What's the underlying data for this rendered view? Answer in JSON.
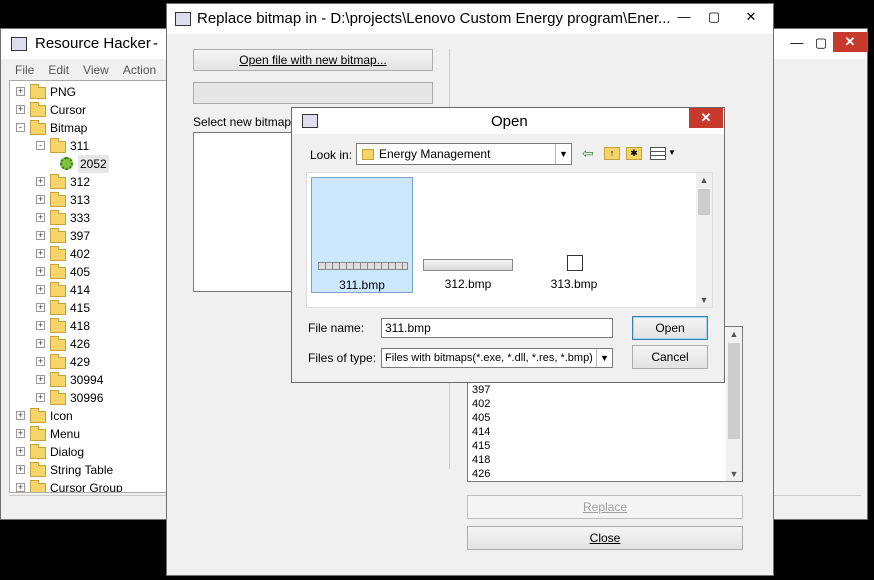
{
  "rh": {
    "title": "Resource Hacker",
    "title_suffix": "-",
    "menu": [
      "File",
      "Edit",
      "View",
      "Action"
    ],
    "tree": [
      {
        "label": "PNG",
        "level": 0,
        "exp": "+"
      },
      {
        "label": "Cursor",
        "level": 0,
        "exp": "+"
      },
      {
        "label": "Bitmap",
        "level": 0,
        "exp": "-"
      },
      {
        "label": "311",
        "level": 1,
        "exp": "-",
        "open": true
      },
      {
        "label": "2052",
        "level": 2,
        "exp": "",
        "gear": true
      },
      {
        "label": "312",
        "level": 1,
        "exp": "+"
      },
      {
        "label": "313",
        "level": 1,
        "exp": "+"
      },
      {
        "label": "333",
        "level": 1,
        "exp": "+"
      },
      {
        "label": "397",
        "level": 1,
        "exp": "+"
      },
      {
        "label": "402",
        "level": 1,
        "exp": "+"
      },
      {
        "label": "405",
        "level": 1,
        "exp": "+"
      },
      {
        "label": "414",
        "level": 1,
        "exp": "+"
      },
      {
        "label": "415",
        "level": 1,
        "exp": "+"
      },
      {
        "label": "418",
        "level": 1,
        "exp": "+"
      },
      {
        "label": "426",
        "level": 1,
        "exp": "+"
      },
      {
        "label": "429",
        "level": 1,
        "exp": "+"
      },
      {
        "label": "30994",
        "level": 1,
        "exp": "+"
      },
      {
        "label": "30996",
        "level": 1,
        "exp": "+"
      },
      {
        "label": "Icon",
        "level": 0,
        "exp": "+"
      },
      {
        "label": "Menu",
        "level": 0,
        "exp": "+"
      },
      {
        "label": "Dialog",
        "level": 0,
        "exp": "+"
      },
      {
        "label": "String Table",
        "level": 0,
        "exp": "+"
      },
      {
        "label": "Cursor Group",
        "level": 0,
        "exp": "+"
      }
    ]
  },
  "rep": {
    "title": "Replace bitmap in - D:\\projects\\Lenovo Custom Energy program\\Ener...",
    "open_btn": "Open file with new bitmap...",
    "select_label": "Select new bitmap:",
    "list": [
      "397",
      "402",
      "405",
      "414",
      "415",
      "418",
      "426"
    ],
    "replace_btn": "Replace",
    "close_btn": "Close"
  },
  "open": {
    "title": "Open",
    "lookin_label": "Look in:",
    "lookin_value": "Energy Management",
    "files": [
      "311.bmp",
      "312.bmp",
      "313.bmp"
    ],
    "filename_label": "File name:",
    "filename_value": "311.bmp",
    "filetype_label": "Files of type:",
    "filetype_value": "Files with bitmaps(*.exe, *.dll, *.res, *.bmp)",
    "open_btn": "Open",
    "cancel_btn": "Cancel"
  },
  "colors": {
    "selection": "#cce8ff",
    "close_red": "#c7392a",
    "folder": "#f3d56a"
  }
}
